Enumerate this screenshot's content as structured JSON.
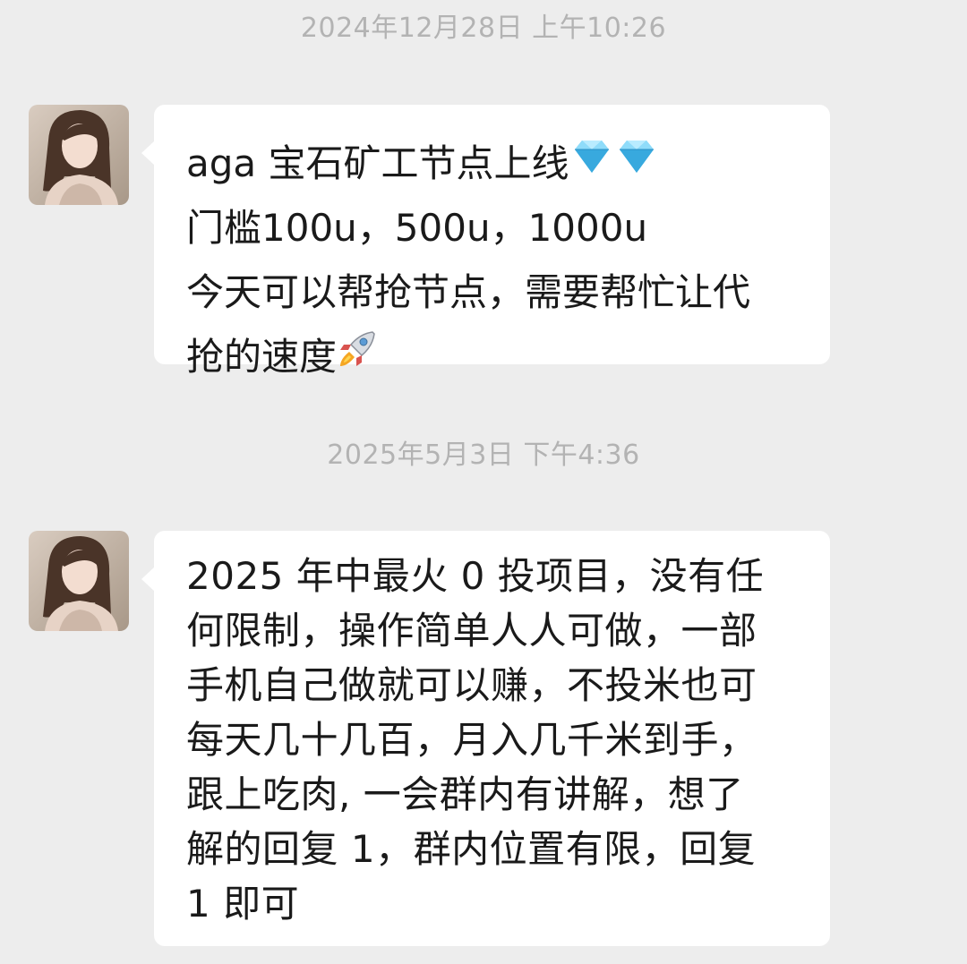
{
  "messages": [
    {
      "timestamp": "2024年12月28日 上午10:26",
      "sender_avatar": "contact-avatar-photo",
      "lines": [
        "aga 宝石矿工节点上线",
        "门槛100u，500u，1000u",
        "今天可以帮抢节点，需要帮忙让代",
        "抢的速度"
      ],
      "emojis": [
        "gem-icon",
        "gem-icon",
        "rocket-icon"
      ]
    },
    {
      "timestamp": "2025年5月3日 下午4:36",
      "sender_avatar": "contact-avatar-photo",
      "lines": [
        "2025 年中最火 0 投项目，没有任",
        "何限制，操作简单人人可做，一部",
        "手机自己做就可以赚，不投米也可",
        "每天几十几百，月入几千米到手，",
        "跟上吃肉, 一会群内有讲解，想了",
        "解的回复 1，群内位置有限，回复",
        "1 即可"
      ]
    }
  ],
  "colors": {
    "background": "#ededed",
    "bubble": "#ffffff",
    "timestamp_text": "#b3b3b3",
    "message_text": "#1a1a1a",
    "gem": "#5bc8f0"
  }
}
